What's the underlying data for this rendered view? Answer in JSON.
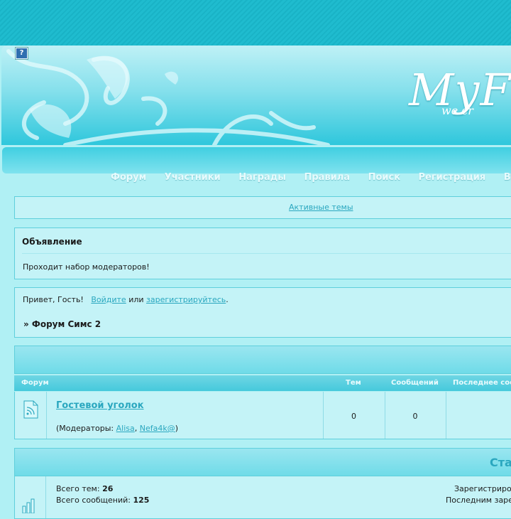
{
  "header": {
    "help_label": "?",
    "logo_text": "MyF",
    "logo_sub": "we cr"
  },
  "nav": {
    "items": [
      "Форум",
      "Участники",
      "Награды",
      "Правила",
      "Поиск",
      "Регистрация",
      "Вх"
    ]
  },
  "active_topics": {
    "link": "Активные темы"
  },
  "announcement": {
    "title": "Объявление",
    "text": "Проходит набор модераторов!"
  },
  "welcome": {
    "greeting": "Привет, Гость!",
    "login_link": "Войдите",
    "or_text": "или",
    "register_link": "зарегистрируйтесь",
    "period": ".",
    "breadcrumb": "» Форум Симс 2"
  },
  "forum_table": {
    "columns": [
      "Форум",
      "Тем",
      "Сообщений",
      "Последнее сооб"
    ],
    "rows": [
      {
        "name": "Гостевой уголок",
        "moderators_prefix": "(Модераторы:",
        "moderators": [
          "Alisa",
          "Nefa4k@"
        ],
        "moderator_sep": ",",
        "moderators_suffix": ")",
        "topics": "0",
        "posts": "0"
      }
    ]
  },
  "stats": {
    "title": "Ста",
    "total_topics_label": "Всего тем:",
    "total_topics": "26",
    "total_posts_label": "Всего сообщений:",
    "total_posts": "125",
    "registered_label": "Зарегистриро",
    "last_registered_label": "Последним заре"
  },
  "colors": {
    "accent": "#2aa7bf",
    "panel": "#c4f3f7",
    "border": "#5fcfdc"
  }
}
